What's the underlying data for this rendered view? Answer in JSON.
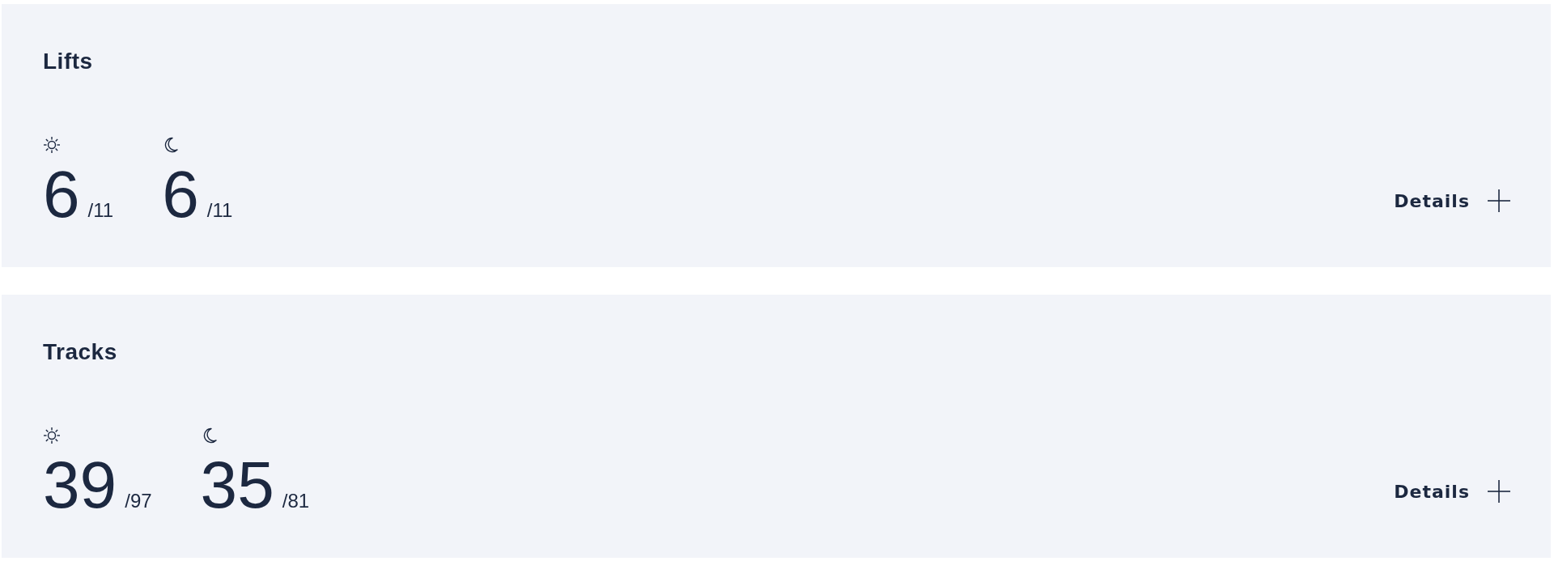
{
  "panels": [
    {
      "title": "Lifts",
      "stats": [
        {
          "kind": "day",
          "value": "6",
          "total": "/11"
        },
        {
          "kind": "night",
          "value": "6",
          "total": "/11"
        }
      ],
      "details": "Details"
    },
    {
      "title": "Tracks",
      "stats": [
        {
          "kind": "day",
          "value": "39",
          "total": "/97"
        },
        {
          "kind": "night",
          "value": "35",
          "total": "/81"
        }
      ],
      "details": "Details"
    }
  ]
}
